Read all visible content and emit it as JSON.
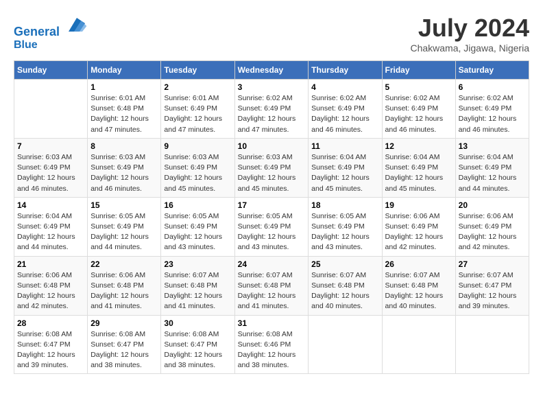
{
  "header": {
    "logo_line1": "General",
    "logo_line2": "Blue",
    "month_title": "July 2024",
    "location": "Chakwama, Jigawa, Nigeria"
  },
  "weekdays": [
    "Sunday",
    "Monday",
    "Tuesday",
    "Wednesday",
    "Thursday",
    "Friday",
    "Saturday"
  ],
  "weeks": [
    [
      {
        "day": "",
        "sunrise": "",
        "sunset": "",
        "daylight": ""
      },
      {
        "day": "1",
        "sunrise": "Sunrise: 6:01 AM",
        "sunset": "Sunset: 6:48 PM",
        "daylight": "Daylight: 12 hours and 47 minutes."
      },
      {
        "day": "2",
        "sunrise": "Sunrise: 6:01 AM",
        "sunset": "Sunset: 6:49 PM",
        "daylight": "Daylight: 12 hours and 47 minutes."
      },
      {
        "day": "3",
        "sunrise": "Sunrise: 6:02 AM",
        "sunset": "Sunset: 6:49 PM",
        "daylight": "Daylight: 12 hours and 47 minutes."
      },
      {
        "day": "4",
        "sunrise": "Sunrise: 6:02 AM",
        "sunset": "Sunset: 6:49 PM",
        "daylight": "Daylight: 12 hours and 46 minutes."
      },
      {
        "day": "5",
        "sunrise": "Sunrise: 6:02 AM",
        "sunset": "Sunset: 6:49 PM",
        "daylight": "Daylight: 12 hours and 46 minutes."
      },
      {
        "day": "6",
        "sunrise": "Sunrise: 6:02 AM",
        "sunset": "Sunset: 6:49 PM",
        "daylight": "Daylight: 12 hours and 46 minutes."
      }
    ],
    [
      {
        "day": "7",
        "sunrise": "Sunrise: 6:03 AM",
        "sunset": "Sunset: 6:49 PM",
        "daylight": "Daylight: 12 hours and 46 minutes."
      },
      {
        "day": "8",
        "sunrise": "Sunrise: 6:03 AM",
        "sunset": "Sunset: 6:49 PM",
        "daylight": "Daylight: 12 hours and 46 minutes."
      },
      {
        "day": "9",
        "sunrise": "Sunrise: 6:03 AM",
        "sunset": "Sunset: 6:49 PM",
        "daylight": "Daylight: 12 hours and 45 minutes."
      },
      {
        "day": "10",
        "sunrise": "Sunrise: 6:03 AM",
        "sunset": "Sunset: 6:49 PM",
        "daylight": "Daylight: 12 hours and 45 minutes."
      },
      {
        "day": "11",
        "sunrise": "Sunrise: 6:04 AM",
        "sunset": "Sunset: 6:49 PM",
        "daylight": "Daylight: 12 hours and 45 minutes."
      },
      {
        "day": "12",
        "sunrise": "Sunrise: 6:04 AM",
        "sunset": "Sunset: 6:49 PM",
        "daylight": "Daylight: 12 hours and 45 minutes."
      },
      {
        "day": "13",
        "sunrise": "Sunrise: 6:04 AM",
        "sunset": "Sunset: 6:49 PM",
        "daylight": "Daylight: 12 hours and 44 minutes."
      }
    ],
    [
      {
        "day": "14",
        "sunrise": "Sunrise: 6:04 AM",
        "sunset": "Sunset: 6:49 PM",
        "daylight": "Daylight: 12 hours and 44 minutes."
      },
      {
        "day": "15",
        "sunrise": "Sunrise: 6:05 AM",
        "sunset": "Sunset: 6:49 PM",
        "daylight": "Daylight: 12 hours and 44 minutes."
      },
      {
        "day": "16",
        "sunrise": "Sunrise: 6:05 AM",
        "sunset": "Sunset: 6:49 PM",
        "daylight": "Daylight: 12 hours and 43 minutes."
      },
      {
        "day": "17",
        "sunrise": "Sunrise: 6:05 AM",
        "sunset": "Sunset: 6:49 PM",
        "daylight": "Daylight: 12 hours and 43 minutes."
      },
      {
        "day": "18",
        "sunrise": "Sunrise: 6:05 AM",
        "sunset": "Sunset: 6:49 PM",
        "daylight": "Daylight: 12 hours and 43 minutes."
      },
      {
        "day": "19",
        "sunrise": "Sunrise: 6:06 AM",
        "sunset": "Sunset: 6:49 PM",
        "daylight": "Daylight: 12 hours and 42 minutes."
      },
      {
        "day": "20",
        "sunrise": "Sunrise: 6:06 AM",
        "sunset": "Sunset: 6:49 PM",
        "daylight": "Daylight: 12 hours and 42 minutes."
      }
    ],
    [
      {
        "day": "21",
        "sunrise": "Sunrise: 6:06 AM",
        "sunset": "Sunset: 6:48 PM",
        "daylight": "Daylight: 12 hours and 42 minutes."
      },
      {
        "day": "22",
        "sunrise": "Sunrise: 6:06 AM",
        "sunset": "Sunset: 6:48 PM",
        "daylight": "Daylight: 12 hours and 41 minutes."
      },
      {
        "day": "23",
        "sunrise": "Sunrise: 6:07 AM",
        "sunset": "Sunset: 6:48 PM",
        "daylight": "Daylight: 12 hours and 41 minutes."
      },
      {
        "day": "24",
        "sunrise": "Sunrise: 6:07 AM",
        "sunset": "Sunset: 6:48 PM",
        "daylight": "Daylight: 12 hours and 41 minutes."
      },
      {
        "day": "25",
        "sunrise": "Sunrise: 6:07 AM",
        "sunset": "Sunset: 6:48 PM",
        "daylight": "Daylight: 12 hours and 40 minutes."
      },
      {
        "day": "26",
        "sunrise": "Sunrise: 6:07 AM",
        "sunset": "Sunset: 6:48 PM",
        "daylight": "Daylight: 12 hours and 40 minutes."
      },
      {
        "day": "27",
        "sunrise": "Sunrise: 6:07 AM",
        "sunset": "Sunset: 6:47 PM",
        "daylight": "Daylight: 12 hours and 39 minutes."
      }
    ],
    [
      {
        "day": "28",
        "sunrise": "Sunrise: 6:08 AM",
        "sunset": "Sunset: 6:47 PM",
        "daylight": "Daylight: 12 hours and 39 minutes."
      },
      {
        "day": "29",
        "sunrise": "Sunrise: 6:08 AM",
        "sunset": "Sunset: 6:47 PM",
        "daylight": "Daylight: 12 hours and 38 minutes."
      },
      {
        "day": "30",
        "sunrise": "Sunrise: 6:08 AM",
        "sunset": "Sunset: 6:47 PM",
        "daylight": "Daylight: 12 hours and 38 minutes."
      },
      {
        "day": "31",
        "sunrise": "Sunrise: 6:08 AM",
        "sunset": "Sunset: 6:46 PM",
        "daylight": "Daylight: 12 hours and 38 minutes."
      },
      {
        "day": "",
        "sunrise": "",
        "sunset": "",
        "daylight": ""
      },
      {
        "day": "",
        "sunrise": "",
        "sunset": "",
        "daylight": ""
      },
      {
        "day": "",
        "sunrise": "",
        "sunset": "",
        "daylight": ""
      }
    ]
  ]
}
